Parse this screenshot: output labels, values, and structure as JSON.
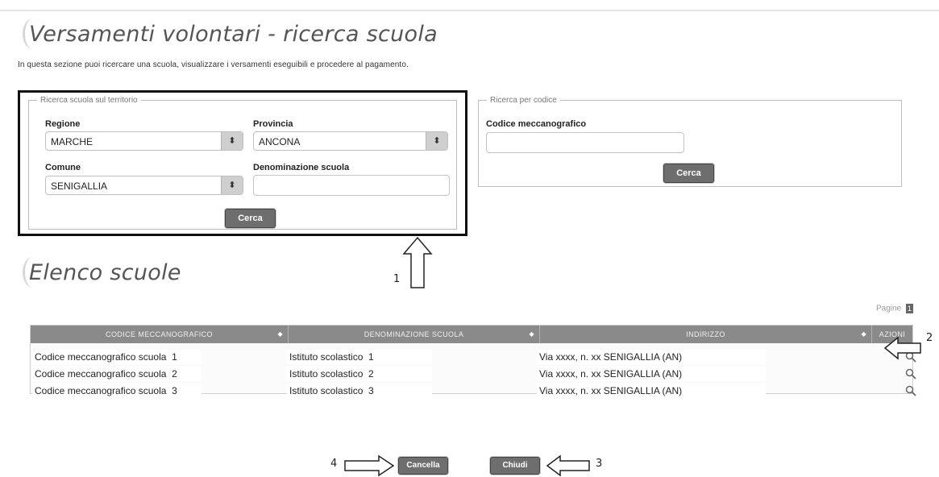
{
  "header": {
    "title": "Versamenti volontari - ricerca scuola",
    "intro": "In questa sezione puoi ricercare una scuola, visualizzare i versamenti eseguibili e procedere al pagamento."
  },
  "search_territory": {
    "legend": "Ricerca scuola sul territorio",
    "regione_label": "Regione",
    "regione_value": "MARCHE",
    "provincia_label": "Provincia",
    "provincia_value": "ANCONA",
    "comune_label": "Comune",
    "comune_value": "SENIGALLIA",
    "denominazione_label": "Denominazione scuola",
    "denominazione_value": "",
    "search_button": "Cerca"
  },
  "search_code": {
    "legend": "Ricerca per codice",
    "code_label": "Codice meccanografico",
    "code_value": "",
    "search_button": "Cerca"
  },
  "results": {
    "title": "Elenco scuole",
    "pager_label": "Pagine",
    "pager_page": "1",
    "columns": [
      "CODICE MECCANOGRAFICO",
      "DENOMINAZIONE SCUOLA",
      "INDIRIZZO",
      "AZIONI"
    ],
    "rows": [
      {
        "code": "Codice meccanografico scuola",
        "code_n": "1",
        "name": "Istituto scolastico",
        "name_n": "1",
        "address": "Via xxxx, n. xx SENIGALLIA (AN)"
      },
      {
        "code": "Codice meccanografico scuola",
        "code_n": "2",
        "name": "Istituto scolastico",
        "name_n": "2",
        "address": "Via xxxx, n. xx SENIGALLIA (AN)"
      },
      {
        "code": "Codice meccanografico scuola",
        "code_n": "3",
        "name": "Istituto scolastico",
        "name_n": "3",
        "address": "Via xxxx, n. xx SENIGALLIA (AN)"
      }
    ],
    "action_icon": "magnifier-icon"
  },
  "footer": {
    "cancel_button": "Cancella",
    "close_button": "Chiudi"
  },
  "annotations": {
    "n1": "1",
    "n2": "2",
    "n3": "3",
    "n4": "4"
  }
}
